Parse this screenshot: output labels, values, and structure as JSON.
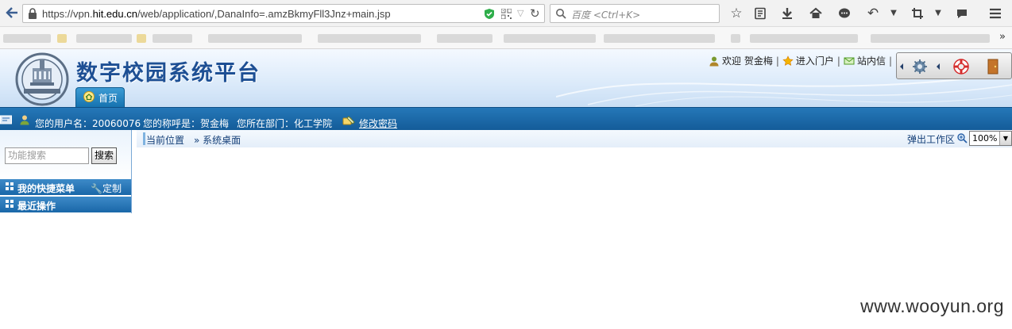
{
  "browser": {
    "url_prefix": "https://vpn.",
    "url_domain": "hit.edu.cn",
    "url_path": "/web/application/,DanaInfo=.amzBkmyFll3Jnz+main.jsp",
    "search_placeholder": "百度 <Ctrl+K>",
    "bookmarks_overflow": "»"
  },
  "header": {
    "site_title": "数字校园系统平台",
    "home_tab": "首页",
    "welcome_prefix": "欢迎",
    "user_name": "贺金梅",
    "portal_link": "进入门户",
    "message_link": "站内信"
  },
  "info_bar": {
    "username_label": "您的用户名：",
    "username": "20060076",
    "title_label": "您的称呼是：",
    "title": "贺金梅",
    "dept_label": "您所在部门：",
    "dept": "化工学院",
    "change_password": "修改密码"
  },
  "sidebar": {
    "search_placeholder": "功能搜索",
    "search_button": "搜索",
    "quick_menu": "我的快捷菜单",
    "customize": "定制",
    "recent": "最近操作"
  },
  "content": {
    "breadcrumb_label": "当前位置",
    "breadcrumb_current": "» 系统桌面",
    "popout": "弹出工作区",
    "zoom_value": "100%"
  },
  "watermark": "www.wooyun.org",
  "colors": {
    "accent": "#1a67a8",
    "title_blue": "#1d4f94",
    "info_bar": "#145c99"
  }
}
